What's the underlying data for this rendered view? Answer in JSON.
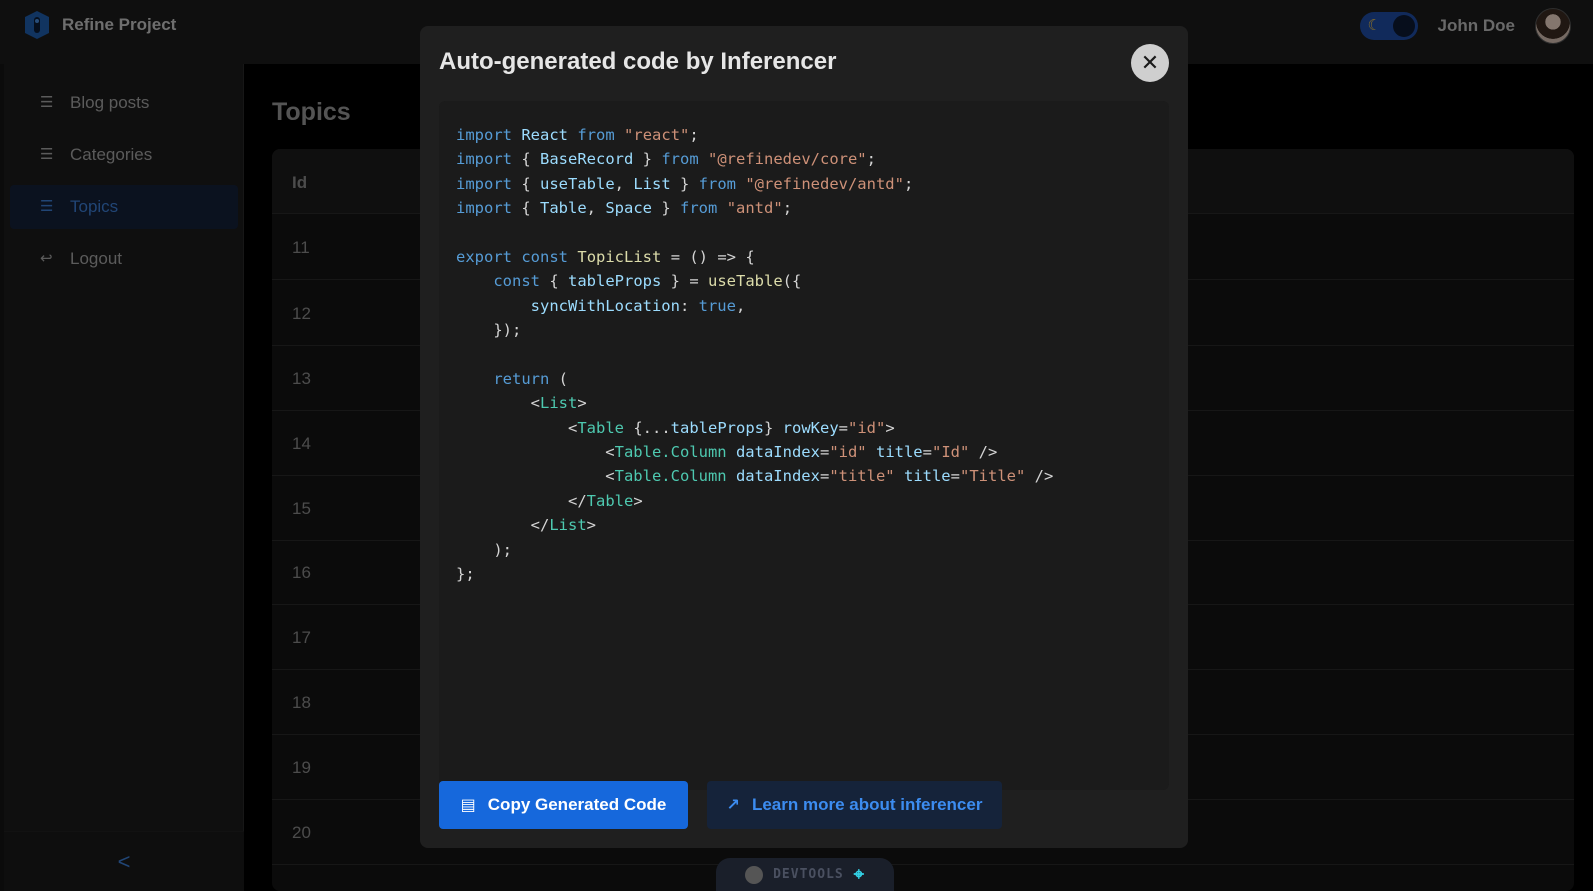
{
  "header": {
    "brand_name": "Refine Project",
    "user_name": "John Doe"
  },
  "sidebar": {
    "items": [
      {
        "label": "Blog posts",
        "icon": "list-icon"
      },
      {
        "label": "Categories",
        "icon": "list-icon"
      },
      {
        "label": "Topics",
        "icon": "list-icon",
        "active": true
      },
      {
        "label": "Logout",
        "icon": "logout-icon"
      }
    ],
    "collapse_glyph": "<"
  },
  "page": {
    "title": "Topics",
    "table": {
      "header": "Id",
      "rows": [
        "11",
        "12",
        "13",
        "14",
        "15",
        "16",
        "17",
        "18",
        "19",
        "20"
      ]
    }
  },
  "modal": {
    "title": "Auto-generated code by Inferencer",
    "copy_button_label": "Copy Generated Code",
    "learn_button_label": "Learn more about inferencer"
  },
  "devtools": {
    "label": "DEVTOOLS"
  },
  "colors": {
    "accent": "#1668dc",
    "active_nav": "#3c7ed6"
  }
}
